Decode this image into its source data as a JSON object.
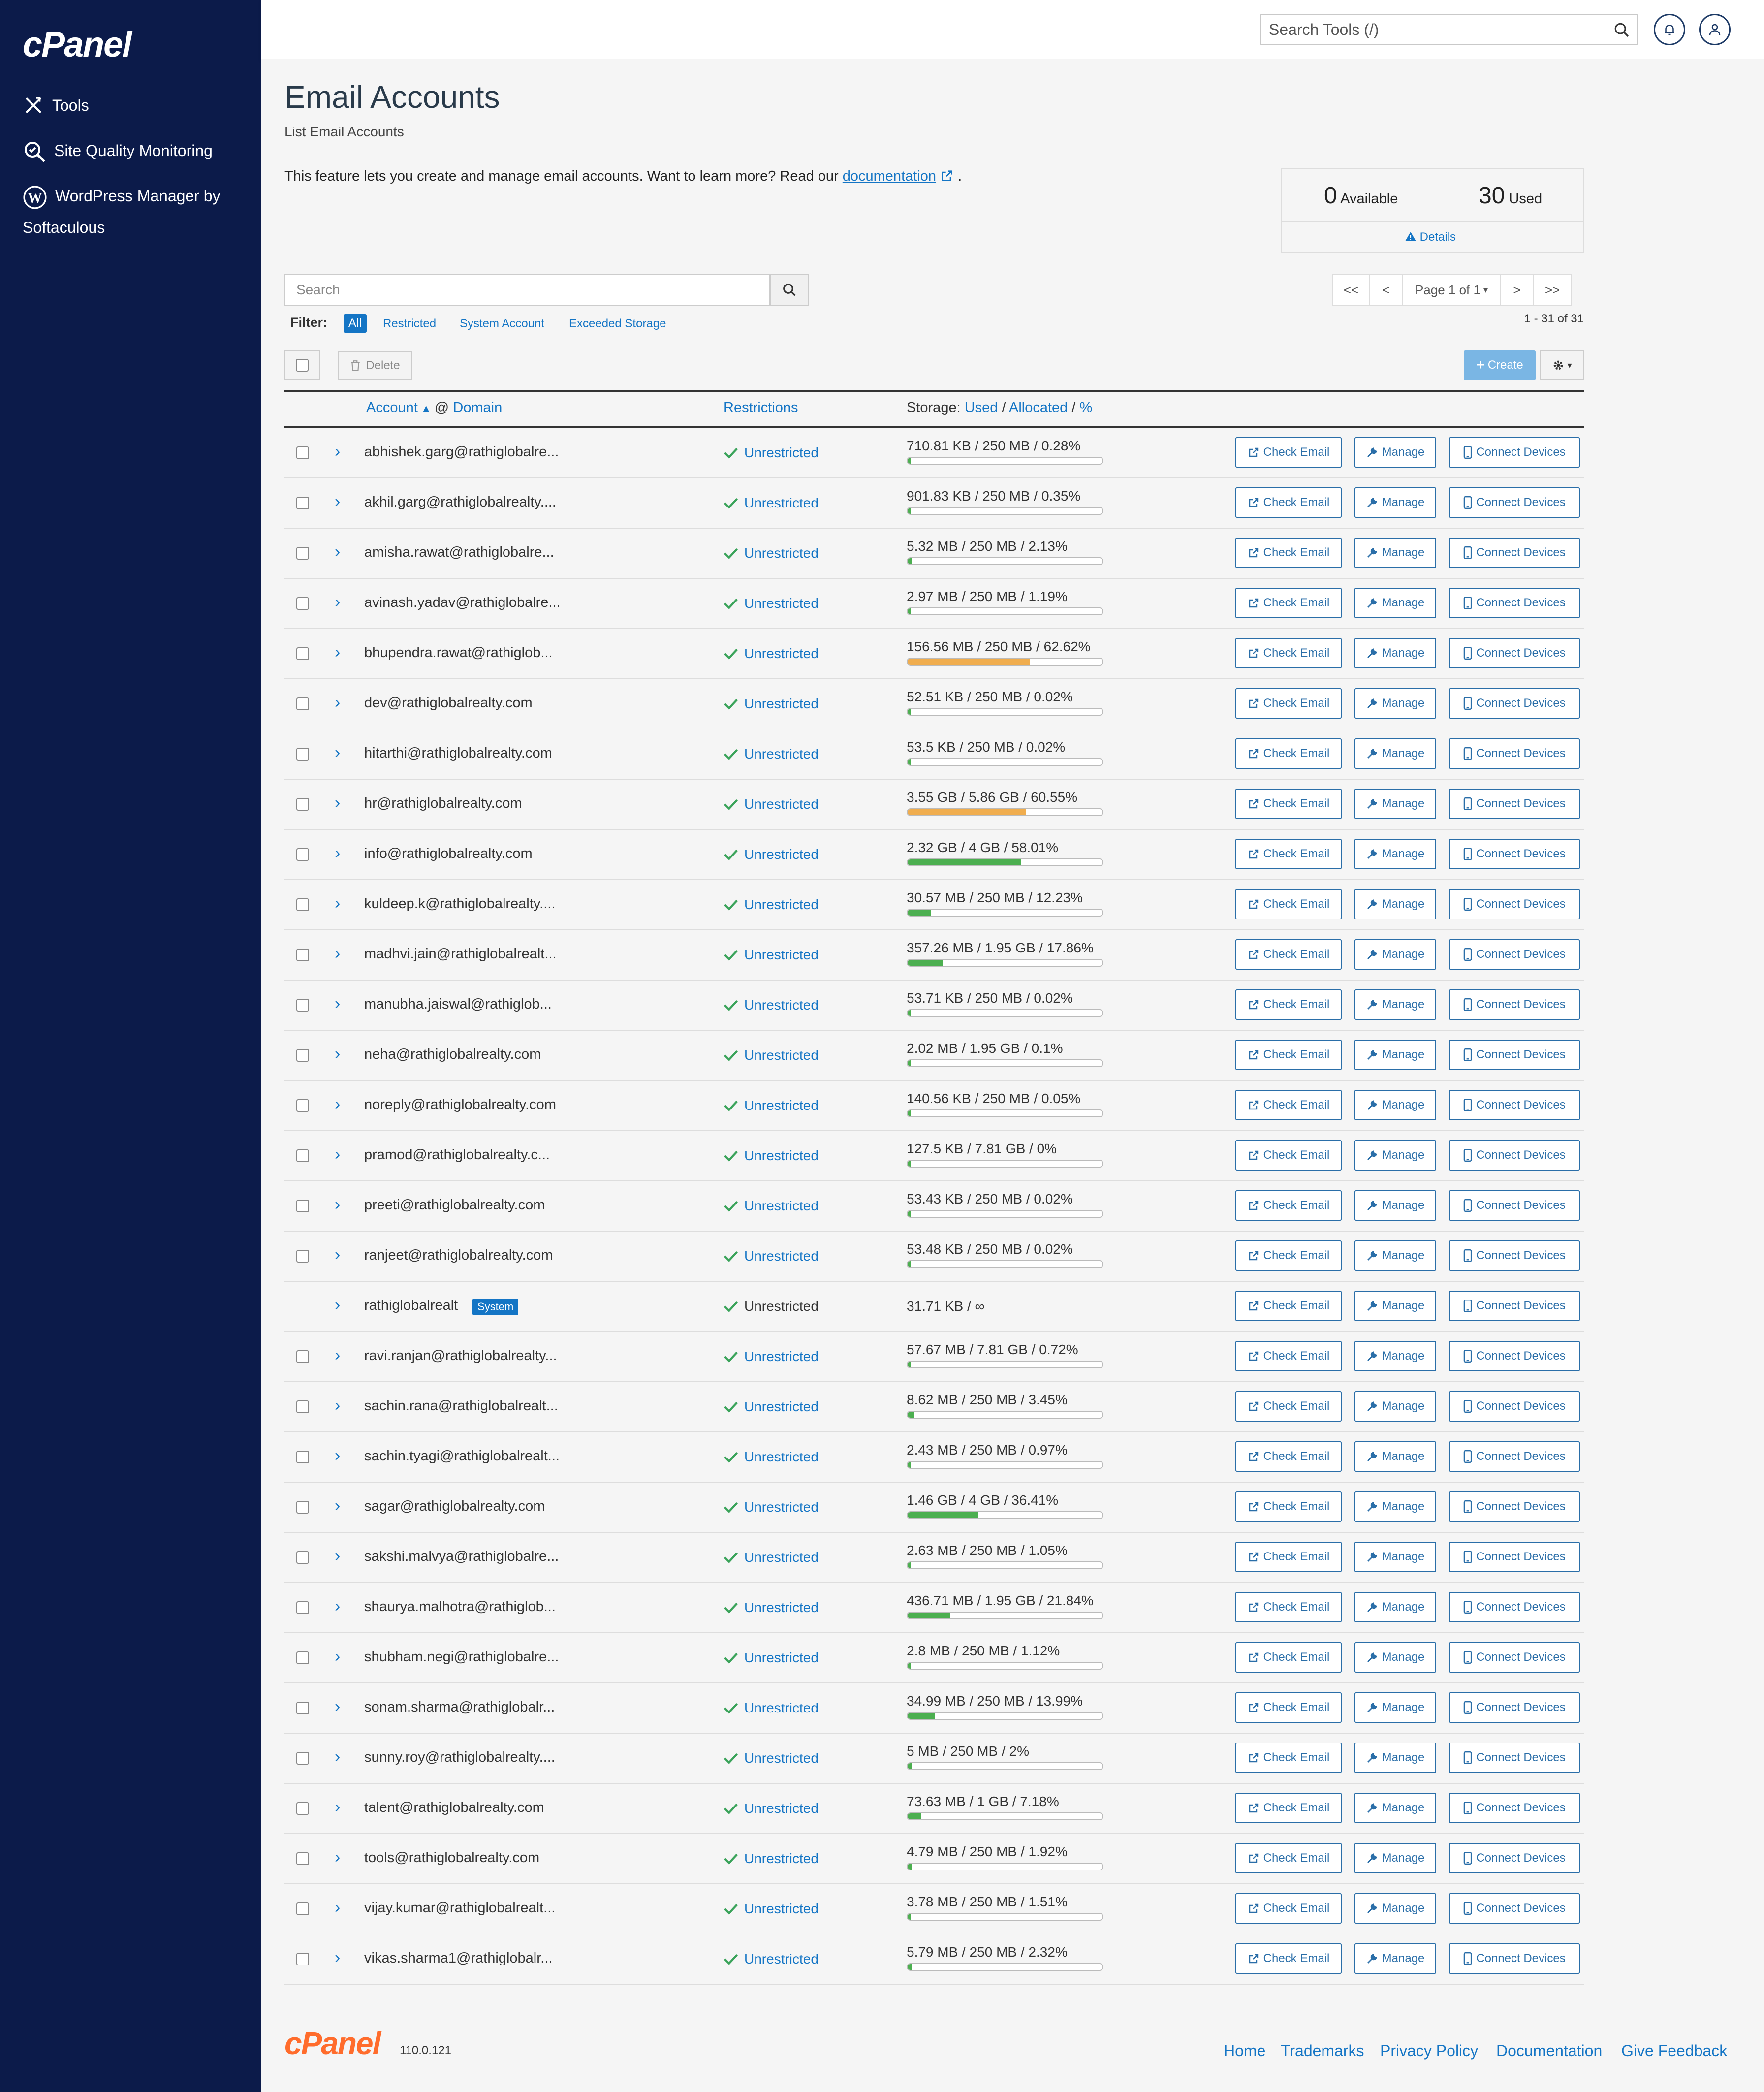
{
  "sidebar": {
    "logo": "cPanel",
    "items": [
      {
        "label": "Tools",
        "icon": "tools-icon"
      },
      {
        "label": "Site Quality Monitoring",
        "icon": "site-quality-icon"
      },
      {
        "label": "WordPress Manager by",
        "label2": "Softaculous",
        "icon": "wordpress-icon"
      }
    ]
  },
  "header": {
    "search_placeholder": "Search Tools (/)"
  },
  "page": {
    "title": "Email Accounts",
    "subtitle": "List Email Accounts",
    "description": "This feature lets you create and manage email accounts. Want to learn more? Read our",
    "doc_link": "documentation",
    "period": "."
  },
  "stats": {
    "available_num": "0",
    "available_label": "Available",
    "used_num": "30",
    "used_label": "Used",
    "details": "Details"
  },
  "search": {
    "placeholder": "Search"
  },
  "filter": {
    "label": "Filter:",
    "options": [
      "All",
      "Restricted",
      "System Account",
      "Exceeded Storage"
    ]
  },
  "pagination": {
    "first": "<<",
    "prev": "<",
    "page": "Page 1 of 1",
    "next": ">",
    "last": ">>",
    "range": "1 - 31 of 31"
  },
  "toolbar": {
    "delete": "Delete",
    "create": "Create"
  },
  "table": {
    "col_account": "Account",
    "col_at": "@",
    "col_domain": "Domain",
    "col_restrictions": "Restrictions",
    "col_storage": "Storage:",
    "col_used": "Used",
    "col_slash1": "/",
    "col_allocated": "Allocated",
    "col_slash2": "/",
    "col_pct": "%",
    "btn_check": "Check Email",
    "btn_manage": "Manage",
    "btn_connect": "Connect Devices",
    "status": "Unrestricted",
    "system_badge": "System",
    "rows": [
      {
        "email": "abhishek.garg@rathiglobalre...",
        "storage": "710.81 KB / 250 MB / 0.28%",
        "pct": 0.28
      },
      {
        "email": "akhil.garg@rathiglobalrealty....",
        "storage": "901.83 KB / 250 MB / 0.35%",
        "pct": 0.35
      },
      {
        "email": "amisha.rawat@rathiglobalre...",
        "storage": "5.32 MB / 250 MB / 2.13%",
        "pct": 2.13
      },
      {
        "email": "avinash.yadav@rathiglobalre...",
        "storage": "2.97 MB / 250 MB / 1.19%",
        "pct": 1.19
      },
      {
        "email": "bhupendra.rawat@rathiglob...",
        "storage": "156.56 MB / 250 MB / 62.62%",
        "pct": 62.62
      },
      {
        "email": "dev@rathiglobalrealty.com",
        "storage": "52.51 KB / 250 MB / 0.02%",
        "pct": 0.02
      },
      {
        "email": "hitarthi@rathiglobalrealty.com",
        "storage": "53.5 KB / 250 MB / 0.02%",
        "pct": 0.02
      },
      {
        "email": "hr@rathiglobalrealty.com",
        "storage": "3.55 GB / 5.86 GB / 60.55%",
        "pct": 60.55
      },
      {
        "email": "info@rathiglobalrealty.com",
        "storage": "2.32 GB / 4 GB / 58.01%",
        "pct": 58.01
      },
      {
        "email": "kuldeep.k@rathiglobalrealty....",
        "storage": "30.57 MB / 250 MB / 12.23%",
        "pct": 12.23
      },
      {
        "email": "madhvi.jain@rathiglobalrealt...",
        "storage": "357.26 MB / 1.95 GB / 17.86%",
        "pct": 17.86
      },
      {
        "email": "manubha.jaiswal@rathiglob...",
        "storage": "53.71 KB / 250 MB / 0.02%",
        "pct": 0.02
      },
      {
        "email": "neha@rathiglobalrealty.com",
        "storage": "2.02 MB / 1.95 GB / 0.1%",
        "pct": 0.1
      },
      {
        "email": "noreply@rathiglobalrealty.com",
        "storage": "140.56 KB / 250 MB / 0.05%",
        "pct": 0.05
      },
      {
        "email": "pramod@rathiglobalrealty.c...",
        "storage": "127.5 KB / 7.81 GB / 0%",
        "pct": 0
      },
      {
        "email": "preeti@rathiglobalrealty.com",
        "storage": "53.43 KB / 250 MB / 0.02%",
        "pct": 0.02
      },
      {
        "email": "ranjeet@rathiglobalrealty.com",
        "storage": "53.48 KB / 250 MB / 0.02%",
        "pct": 0.02
      },
      {
        "email": "rathiglobalrealt",
        "storage": "31.71 KB / ∞",
        "pct": null,
        "system": true
      },
      {
        "email": "ravi.ranjan@rathiglobalrealty...",
        "storage": "57.67 MB / 7.81 GB / 0.72%",
        "pct": 0.72
      },
      {
        "email": "sachin.rana@rathiglobalrealt...",
        "storage": "8.62 MB / 250 MB / 3.45%",
        "pct": 3.45
      },
      {
        "email": "sachin.tyagi@rathiglobalrealt...",
        "storage": "2.43 MB / 250 MB / 0.97%",
        "pct": 0.97
      },
      {
        "email": "sagar@rathiglobalrealty.com",
        "storage": "1.46 GB / 4 GB / 36.41%",
        "pct": 36.41
      },
      {
        "email": "sakshi.malvya@rathiglobalre...",
        "storage": "2.63 MB / 250 MB / 1.05%",
        "pct": 1.05
      },
      {
        "email": "shaurya.malhotra@rathiglob...",
        "storage": "436.71 MB / 1.95 GB / 21.84%",
        "pct": 21.84
      },
      {
        "email": "shubham.negi@rathiglobalre...",
        "storage": "2.8 MB / 250 MB / 1.12%",
        "pct": 1.12
      },
      {
        "email": "sonam.sharma@rathiglobalr...",
        "storage": "34.99 MB / 250 MB / 13.99%",
        "pct": 13.99
      },
      {
        "email": "sunny.roy@rathiglobalrealty....",
        "storage": "5 MB / 250 MB / 2%",
        "pct": 2
      },
      {
        "email": "talent@rathiglobalrealty.com",
        "storage": "73.63 MB / 1 GB / 7.18%",
        "pct": 7.18
      },
      {
        "email": "tools@rathiglobalrealty.com",
        "storage": "4.79 MB / 250 MB / 1.92%",
        "pct": 1.92
      },
      {
        "email": "vijay.kumar@rathiglobalrealt...",
        "storage": "3.78 MB / 250 MB / 1.51%",
        "pct": 1.51
      },
      {
        "email": "vikas.sharma1@rathiglobalr...",
        "storage": "5.79 MB / 250 MB / 2.32%",
        "pct": 2.32
      }
    ]
  },
  "footer": {
    "logo": "cPanel",
    "version": "110.0.121",
    "links": [
      "Home",
      "Trademarks",
      "Privacy Policy",
      "Documentation",
      "Give Feedback"
    ]
  },
  "colors": {
    "sidebar": "#0c1b4a",
    "link": "#1475c5",
    "bar_green": "#4caf50",
    "bar_orange": "#f0ad4e",
    "footer_logo": "#ff6c2c",
    "create_btn": "#7ab6e4"
  }
}
